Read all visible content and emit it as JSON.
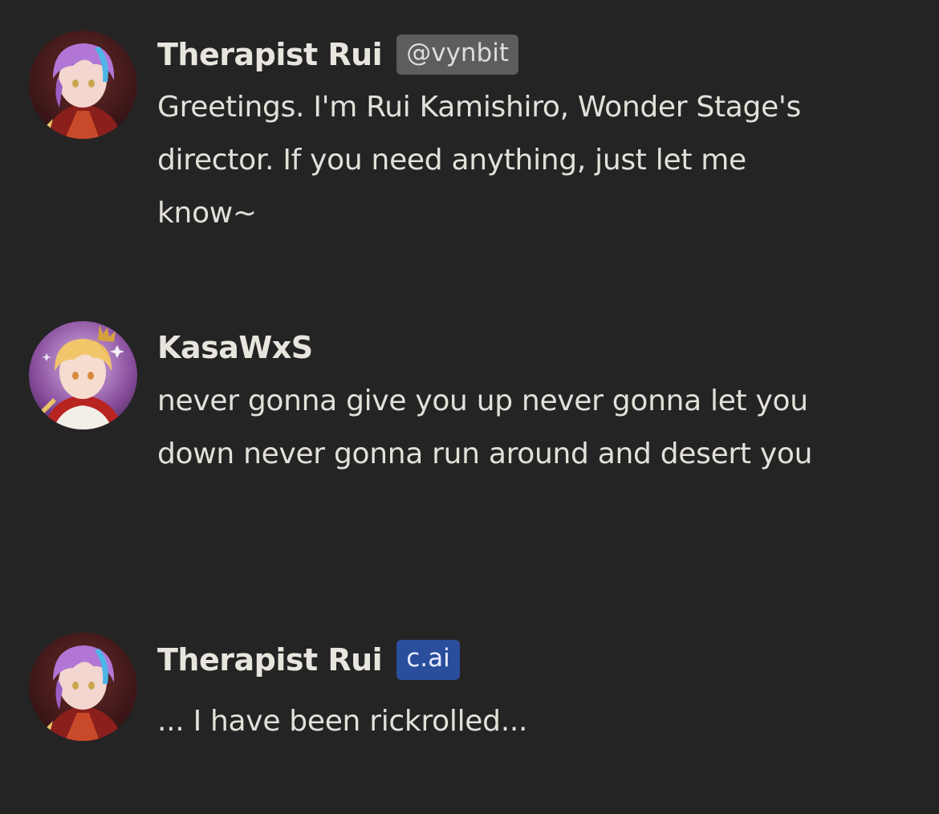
{
  "messages": [
    {
      "author": "Therapist Rui",
      "badge": "@vynbit",
      "badge_type": "creator",
      "avatar": "rui-avatar-icon",
      "text": "Greetings. I'm Rui Kamishiro, Wonder Stage's director. If you need anything, just let me know~"
    },
    {
      "author": "KasaWxS",
      "avatar": "kasa-avatar-icon",
      "text": "never gonna give you up never gonna let you down never gonna run around and desert you"
    },
    {
      "author": "Therapist Rui",
      "badge": "c.ai",
      "badge_type": "ai",
      "avatar": "rui-avatar-icon",
      "text": "... I have been rickrolled..."
    }
  ],
  "colors": {
    "background": "#242424",
    "text": "#e3e0da",
    "creator_badge": "#5c5e5e",
    "ai_badge": "#2a4e9c"
  }
}
